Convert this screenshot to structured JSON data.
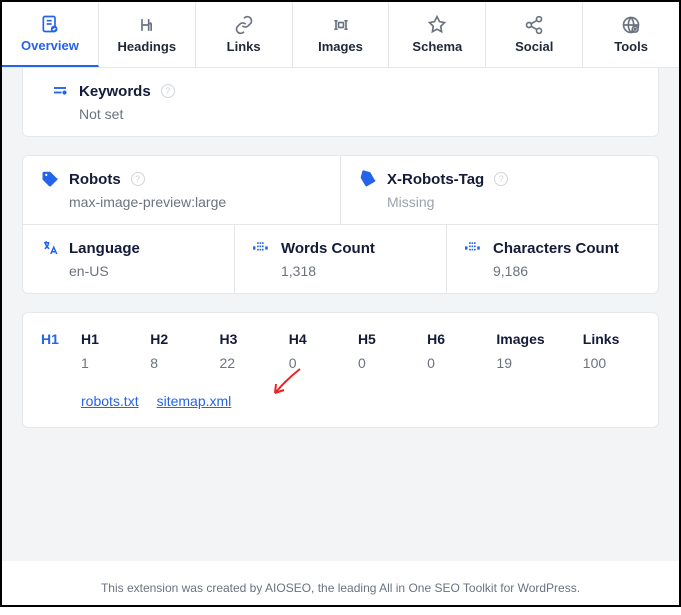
{
  "tabs": [
    {
      "label": "Overview"
    },
    {
      "label": "Headings"
    },
    {
      "label": "Links"
    },
    {
      "label": "Images"
    },
    {
      "label": "Schema"
    },
    {
      "label": "Social"
    },
    {
      "label": "Tools"
    }
  ],
  "keywords": {
    "label": "Keywords",
    "value": "Not set"
  },
  "robots": {
    "label": "Robots",
    "value": "max-image-preview:large"
  },
  "xrobots": {
    "label": "X-Robots-Tag",
    "value": "Missing"
  },
  "language": {
    "label": "Language",
    "value": "en-US"
  },
  "words": {
    "label": "Words Count",
    "value": "1,318"
  },
  "chars": {
    "label": "Characters Count",
    "value": "9,186"
  },
  "headings": {
    "badge": "H1",
    "cols": [
      {
        "head": "H1",
        "val": "1"
      },
      {
        "head": "H2",
        "val": "8"
      },
      {
        "head": "H3",
        "val": "22"
      },
      {
        "head": "H4",
        "val": "0"
      },
      {
        "head": "H5",
        "val": "0"
      },
      {
        "head": "H6",
        "val": "0"
      },
      {
        "head": "Images",
        "val": "19"
      },
      {
        "head": "Links",
        "val": "100"
      }
    ]
  },
  "files": {
    "robots": "robots.txt",
    "sitemap": "sitemap.xml"
  },
  "footer": "This extension was created by AIOSEO, the leading All in One SEO Toolkit for WordPress."
}
